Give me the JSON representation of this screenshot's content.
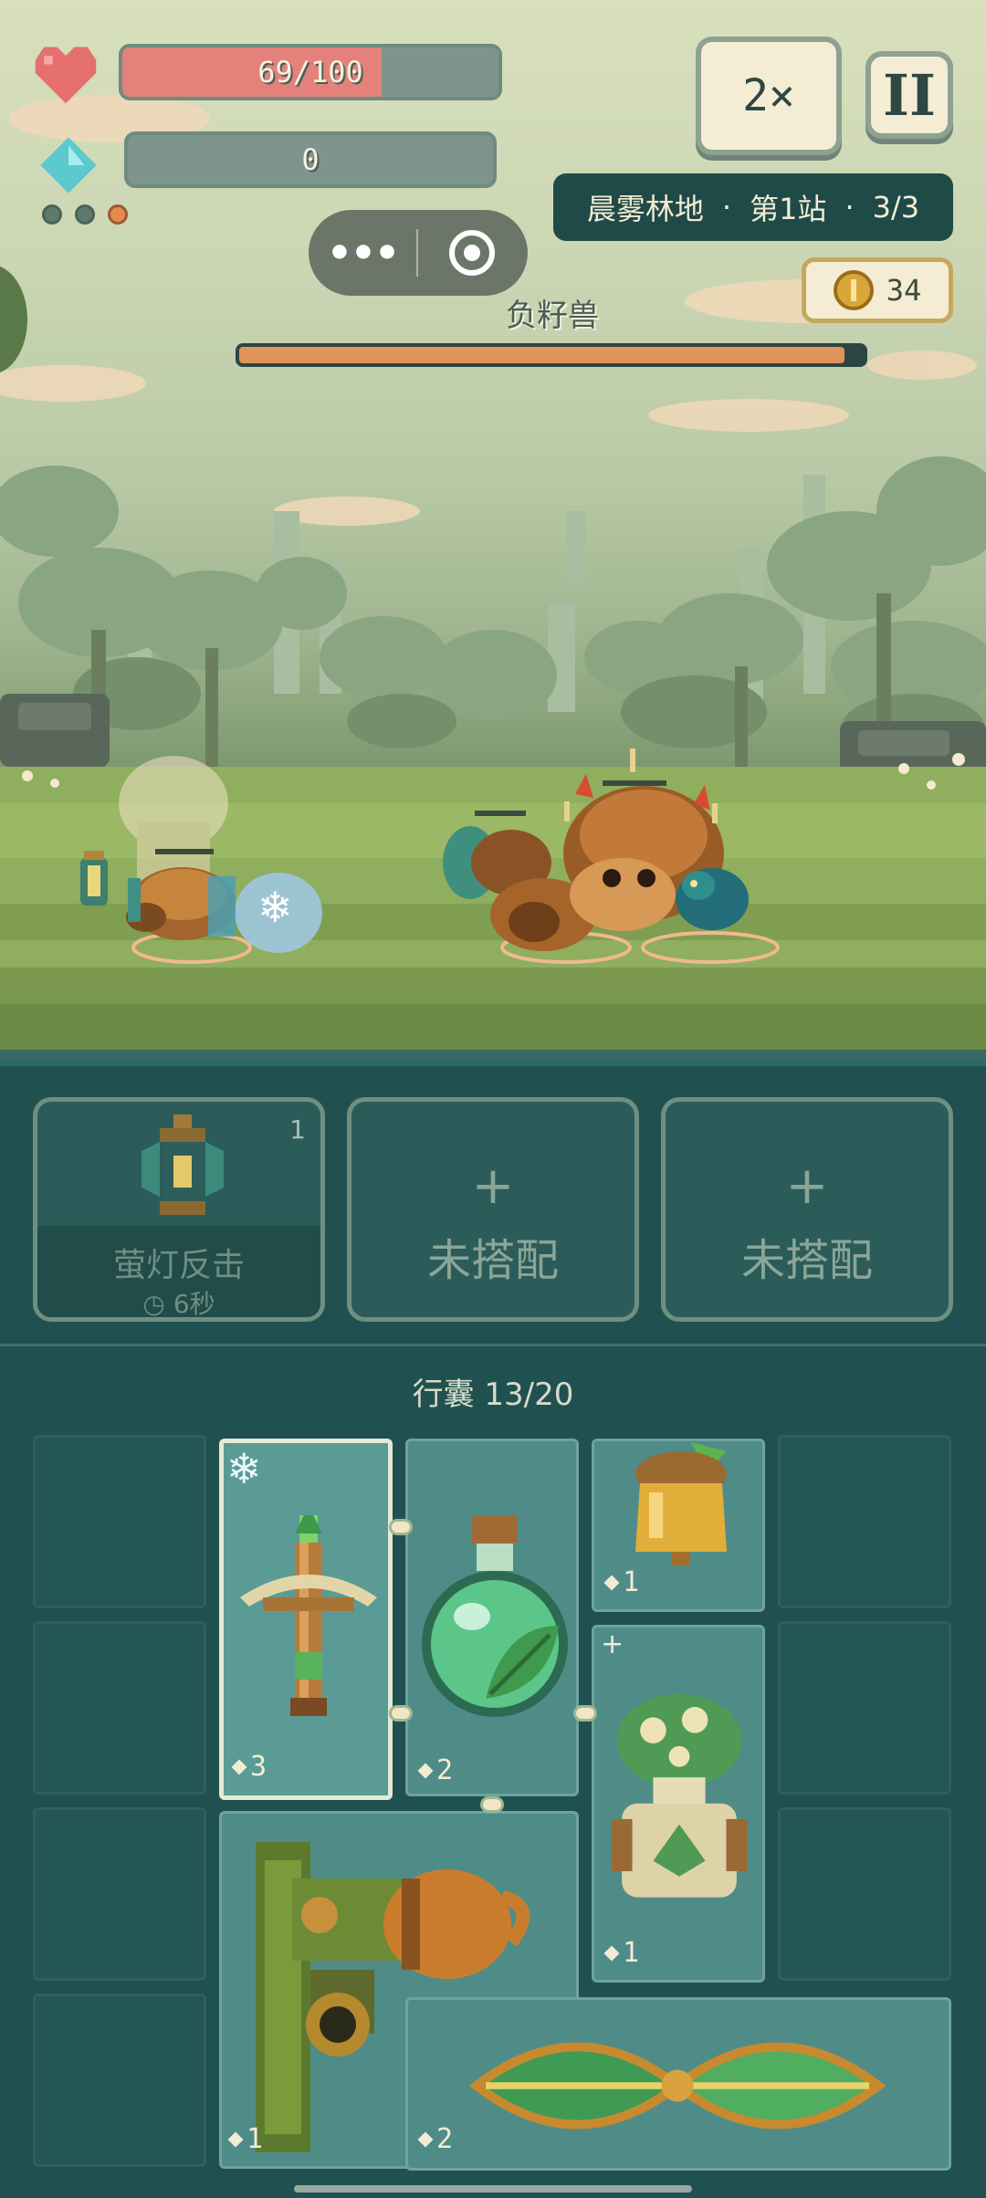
{
  "hud": {
    "hp_text": "69/100",
    "hp_fraction": 0.69,
    "mana_text": "0",
    "speed_label": "2×",
    "pause_label": "II",
    "stage": {
      "area": "晨雾林地",
      "dot": "·",
      "station": "第1站",
      "wave": "3/3"
    },
    "gold": "34",
    "boss_name": "负籽兽",
    "boss_hp_fraction": 0.97
  },
  "skill_slots": [
    {
      "name": "萤灯反击",
      "count": "1",
      "cooldown": "6秒",
      "icon": "lantern-icon"
    },
    {
      "plus": "+",
      "name": "未搭配"
    },
    {
      "plus": "+",
      "name": "未搭配"
    }
  ],
  "bag": {
    "title": "行囊 13/20",
    "items": [
      {
        "name": "crossbow",
        "level": "3",
        "frozen_icon": "❄"
      },
      {
        "name": "leaf-potion",
        "level": "2"
      },
      {
        "name": "acorn-bell",
        "level": "1"
      },
      {
        "name": "mushroom-jar",
        "level": "1",
        "plus": "+"
      },
      {
        "name": "acorn-cannon",
        "level": "1"
      },
      {
        "name": "leaf-blade",
        "level": "2"
      }
    ]
  },
  "colors": {
    "hp": "#e4817a",
    "boss_hp": "#e0945a",
    "panel": "#205150",
    "cell_filled": "#4f8c88"
  }
}
